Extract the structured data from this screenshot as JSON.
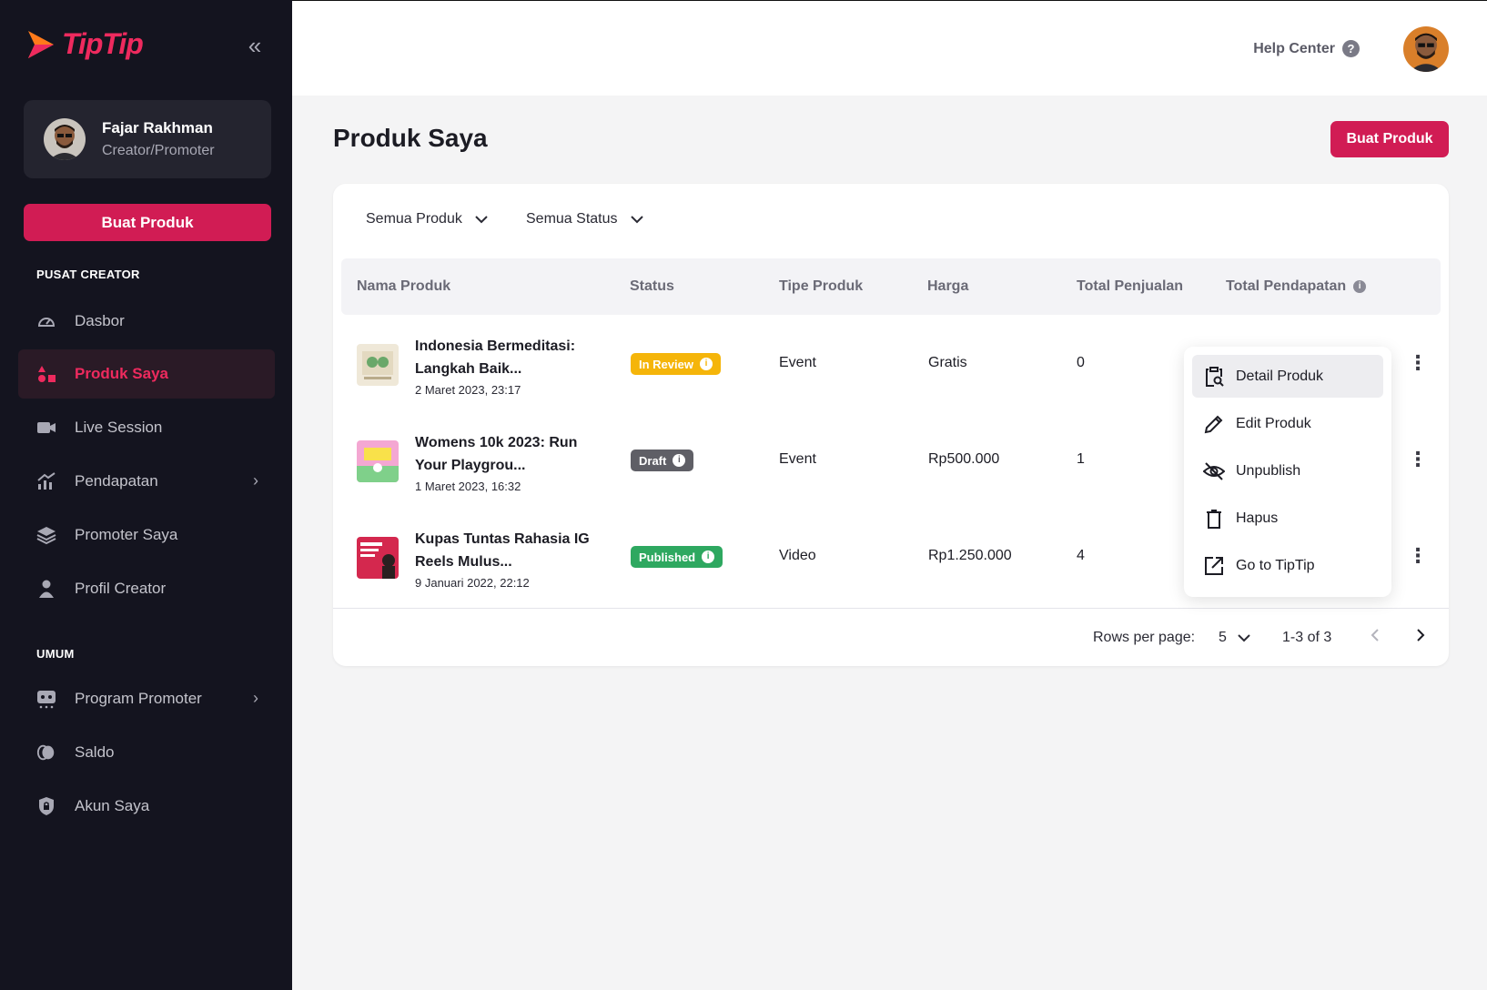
{
  "brand": {
    "name": "TipTip",
    "accent": "#d11c54"
  },
  "sidebar": {
    "collapse_icon": "double-chevron-left-icon",
    "profile": {
      "name": "Fajar Rakhman",
      "role": "Creator/Promoter"
    },
    "create_label": "Buat Produk",
    "section_creator": "PUSAT CREATOR",
    "section_general": "UMUM",
    "creator_items": [
      {
        "label": "Dasbor",
        "icon": "gauge-icon"
      },
      {
        "label": "Produk Saya",
        "icon": "shapes-icon",
        "active": true
      },
      {
        "label": "Live Session",
        "icon": "video-icon"
      },
      {
        "label": "Pendapatan",
        "icon": "chart-icon"
      },
      {
        "label": "Promoter Saya",
        "icon": "layers-icon"
      },
      {
        "label": "Profil Creator",
        "icon": "person-icon"
      }
    ],
    "general_items": [
      {
        "label": "Program Promoter",
        "icon": "program-icon"
      },
      {
        "label": "Saldo",
        "icon": "coins-icon"
      },
      {
        "label": "Akun Saya",
        "icon": "shield-lock-icon"
      }
    ]
  },
  "header": {
    "help_label": "Help Center"
  },
  "page": {
    "title": "Produk Saya",
    "create_label": "Buat Produk"
  },
  "filters": {
    "product": "Semua Produk",
    "status": "Semua Status"
  },
  "table": {
    "columns": [
      "Nama Produk",
      "Status",
      "Tipe Produk",
      "Harga",
      "Total Penjualan",
      "Total Pendapatan"
    ],
    "rows": [
      {
        "name_line1": "Indonesia Bermeditasi:",
        "name_line2": "Langkah Baik...",
        "date": "2 Maret 2023, 23:17",
        "status": "In Review",
        "status_color": "#f5b50a",
        "type": "Event",
        "price": "Gratis",
        "sales": "0"
      },
      {
        "name_line1": "Womens 10k 2023: Run",
        "name_line2": "Your Playgrou...",
        "date": "1 Maret 2023, 16:32",
        "status": "Draft",
        "status_color": "#5f5f66",
        "type": "Event",
        "price": "Rp500.000",
        "sales": "1"
      },
      {
        "name_line1": "Kupas Tuntas Rahasia IG",
        "name_line2": "Reels Mulus...",
        "date": "9 Januari 2022, 22:12",
        "status": "Published",
        "status_color": "#2ea860",
        "type": "Video",
        "price": "Rp1.250.000",
        "sales": "4"
      }
    ]
  },
  "pagination": {
    "rows_label": "Rows per page:",
    "rows_value": "5",
    "range": "1-3 of 3"
  },
  "menu": {
    "items": [
      {
        "label": "Detail Produk",
        "icon": "clipboard-search-icon"
      },
      {
        "label": "Edit Produk",
        "icon": "pencil-icon"
      },
      {
        "label": "Unpublish",
        "icon": "eye-off-icon"
      },
      {
        "label": "Hapus",
        "icon": "trash-icon"
      },
      {
        "label": "Go to TipTip",
        "icon": "external-link-icon"
      }
    ]
  }
}
